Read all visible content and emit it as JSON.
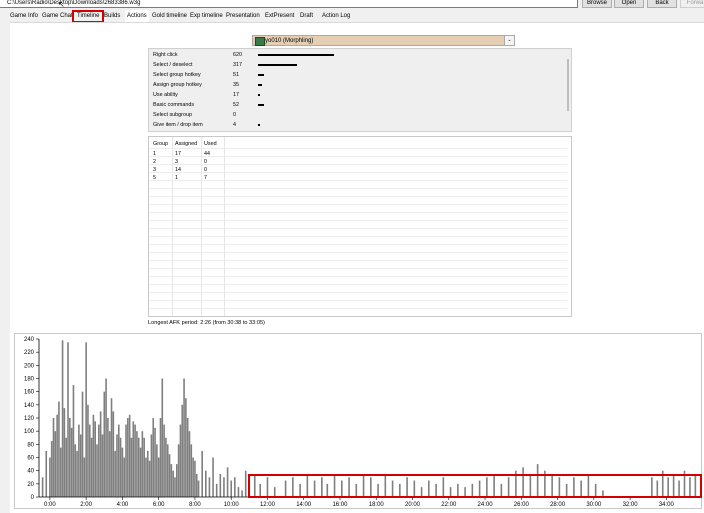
{
  "toolbar": {
    "path": "C:\\Users\\Radio\\Desktop\\Downloads\\2683386.w3g",
    "browse": "Browse",
    "open": "Open",
    "back": "Back",
    "forward": "Forwa"
  },
  "tabs": [
    {
      "label": "Game Info"
    },
    {
      "label": "Game Chat"
    },
    {
      "label": "Timeline"
    },
    {
      "label": "Builds"
    },
    {
      "label": "Actions"
    },
    {
      "label": "Gold timeline"
    },
    {
      "label": "Exp timeline"
    },
    {
      "label": "Presentation"
    },
    {
      "label": "ExtPresent"
    },
    {
      "label": "Draft"
    },
    {
      "label": "Action Log"
    }
  ],
  "player_select": {
    "label": "yo010 (Morphling)",
    "icon": "hero-portrait-icon"
  },
  "actions": [
    {
      "name": "Right click",
      "count": "620",
      "value": 620
    },
    {
      "name": "Select / deselect",
      "count": "317",
      "value": 317
    },
    {
      "name": "Select group hotkey",
      "count": "51",
      "value": 51
    },
    {
      "name": "Assign group hotkey",
      "count": "35",
      "value": 35
    },
    {
      "name": "Use ability",
      "count": "17",
      "value": 17
    },
    {
      "name": "Basic commands",
      "count": "52",
      "value": 52
    },
    {
      "name": "Select subgroup",
      "count": "0",
      "value": 0
    },
    {
      "name": "Give item / drop item",
      "count": "4",
      "value": 4
    }
  ],
  "groups": {
    "headers": [
      "Group",
      "Assigned",
      "Used"
    ],
    "rows": [
      [
        "1",
        "17",
        "44"
      ],
      [
        "2",
        "3",
        "0"
      ],
      [
        "3",
        "14",
        "0"
      ],
      [
        "5",
        "1",
        "7"
      ]
    ]
  },
  "afk": "Longest AFK period: 2:26 (from 30:38 to 33:05)",
  "colors": {
    "accent_highlight": "#d40000",
    "bar": "#7f7f7f",
    "axis": "#000000"
  },
  "chart_data": {
    "type": "bar",
    "title": "",
    "xlabel": "",
    "ylabel": "",
    "ylim": [
      0,
      240
    ],
    "yticks": [
      "240",
      "220",
      "200",
      "180",
      "160",
      "140",
      "120",
      "100",
      "80",
      "60",
      "40",
      "20",
      "0"
    ],
    "xticks": [
      "0:00",
      "2:00",
      "4:00",
      "6:00",
      "8:00",
      "10:00",
      "12:00",
      "14:00",
      "16:00",
      "18:00",
      "20:00",
      "22:00",
      "24:00",
      "26:00",
      "28:00",
      "30:00",
      "32:00",
      "34:00"
    ],
    "xrange_minutes": [
      -0.6,
      35.8
    ],
    "series": [
      {
        "name": "",
        "values": [
          [
            -0.4,
            30
          ],
          [
            -0.2,
            70
          ],
          [
            0.0,
            60
          ],
          [
            0.1,
            85
          ],
          [
            0.2,
            120
          ],
          [
            0.3,
            100
          ],
          [
            0.4,
            125
          ],
          [
            0.5,
            145
          ],
          [
            0.6,
            75
          ],
          [
            0.7,
            238
          ],
          [
            0.8,
            135
          ],
          [
            0.9,
            90
          ],
          [
            1.0,
            235
          ],
          [
            1.1,
            120
          ],
          [
            1.2,
            105
          ],
          [
            1.3,
            170
          ],
          [
            1.4,
            80
          ],
          [
            1.5,
            70
          ],
          [
            1.6,
            110
          ],
          [
            1.7,
            95
          ],
          [
            1.8,
            160
          ],
          [
            1.9,
            60
          ],
          [
            2.0,
            235
          ],
          [
            2.1,
            140
          ],
          [
            2.2,
            110
          ],
          [
            2.3,
            90
          ],
          [
            2.4,
            125
          ],
          [
            2.5,
            115
          ],
          [
            2.6,
            80
          ],
          [
            2.7,
            110
          ],
          [
            2.8,
            130
          ],
          [
            2.9,
            95
          ],
          [
            3.0,
            160
          ],
          [
            3.1,
            180
          ],
          [
            3.2,
            120
          ],
          [
            3.3,
            100
          ],
          [
            3.4,
            150
          ],
          [
            3.5,
            130
          ],
          [
            3.6,
            70
          ],
          [
            3.7,
            95
          ],
          [
            3.8,
            110
          ],
          [
            3.9,
            90
          ],
          [
            4.0,
            75
          ],
          [
            4.1,
            60
          ],
          [
            4.2,
            110
          ],
          [
            4.3,
            120
          ],
          [
            4.4,
            125
          ],
          [
            4.5,
            90
          ],
          [
            4.6,
            115
          ],
          [
            4.7,
            110
          ],
          [
            4.8,
            100
          ],
          [
            4.9,
            90
          ],
          [
            5.0,
            75
          ],
          [
            5.1,
            100
          ],
          [
            5.2,
            90
          ],
          [
            5.3,
            60
          ],
          [
            5.4,
            70
          ],
          [
            5.5,
            55
          ],
          [
            5.6,
            95
          ],
          [
            5.7,
            120
          ],
          [
            5.8,
            105
          ],
          [
            5.9,
            80
          ],
          [
            6.0,
            60
          ],
          [
            6.1,
            120
          ],
          [
            6.2,
            180
          ],
          [
            6.3,
            110
          ],
          [
            6.4,
            90
          ],
          [
            6.5,
            80
          ],
          [
            6.6,
            65
          ],
          [
            6.7,
            50
          ],
          [
            6.8,
            40
          ],
          [
            6.9,
            30
          ],
          [
            7.0,
            50
          ],
          [
            7.1,
            80
          ],
          [
            7.2,
            110
          ],
          [
            7.3,
            140
          ],
          [
            7.4,
            180
          ],
          [
            7.5,
            150
          ],
          [
            7.6,
            120
          ],
          [
            7.7,
            100
          ],
          [
            7.8,
            80
          ],
          [
            7.9,
            60
          ],
          [
            8.0,
            55
          ],
          [
            8.1,
            35
          ],
          [
            8.2,
            25
          ],
          [
            8.4,
            70
          ],
          [
            8.6,
            40
          ],
          [
            8.8,
            30
          ],
          [
            9.0,
            60
          ],
          [
            9.2,
            20
          ],
          [
            9.4,
            35
          ],
          [
            9.6,
            30
          ],
          [
            9.8,
            45
          ],
          [
            10.0,
            25
          ],
          [
            10.2,
            30
          ],
          [
            10.4,
            15
          ],
          [
            10.6,
            10
          ],
          [
            10.8,
            40
          ],
          [
            11.0,
            30
          ],
          [
            11.3,
            35
          ],
          [
            11.6,
            20
          ],
          [
            12.0,
            30
          ],
          [
            12.4,
            15
          ],
          [
            13.0,
            25
          ],
          [
            13.4,
            30
          ],
          [
            13.8,
            20
          ],
          [
            14.2,
            35
          ],
          [
            14.6,
            25
          ],
          [
            15.0,
            30
          ],
          [
            15.3,
            20
          ],
          [
            15.7,
            35
          ],
          [
            16.1,
            25
          ],
          [
            16.5,
            30
          ],
          [
            16.9,
            20
          ],
          [
            17.3,
            35
          ],
          [
            17.7,
            30
          ],
          [
            18.1,
            20
          ],
          [
            18.5,
            35
          ],
          [
            18.9,
            25
          ],
          [
            19.3,
            20
          ],
          [
            19.7,
            30
          ],
          [
            20.1,
            25
          ],
          [
            20.5,
            15
          ],
          [
            20.9,
            25
          ],
          [
            21.3,
            20
          ],
          [
            21.7,
            30
          ],
          [
            22.1,
            15
          ],
          [
            22.5,
            20
          ],
          [
            22.9,
            15
          ],
          [
            23.3,
            20
          ],
          [
            23.7,
            25
          ],
          [
            24.1,
            30
          ],
          [
            24.5,
            35
          ],
          [
            24.9,
            20
          ],
          [
            25.3,
            30
          ],
          [
            25.7,
            40
          ],
          [
            26.1,
            45
          ],
          [
            26.5,
            35
          ],
          [
            26.9,
            50
          ],
          [
            27.3,
            40
          ],
          [
            27.7,
            35
          ],
          [
            28.1,
            30
          ],
          [
            28.5,
            20
          ],
          [
            28.9,
            30
          ],
          [
            29.3,
            25
          ],
          [
            29.7,
            35
          ],
          [
            30.1,
            20
          ],
          [
            30.5,
            10
          ],
          [
            33.2,
            30
          ],
          [
            33.5,
            25
          ],
          [
            33.8,
            40
          ],
          [
            34.1,
            30
          ],
          [
            34.4,
            35
          ],
          [
            34.7,
            25
          ],
          [
            35.0,
            40
          ],
          [
            35.3,
            30
          ],
          [
            35.6,
            35
          ]
        ]
      }
    ]
  }
}
